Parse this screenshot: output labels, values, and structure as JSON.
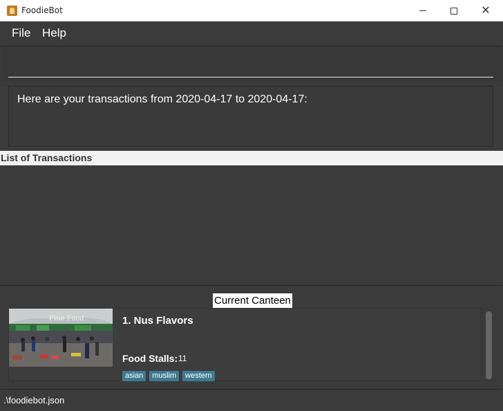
{
  "window": {
    "title": "FoodieBot",
    "minimize_icon": "minimize-icon",
    "maximize_icon": "maximize-icon",
    "close_label": "✕"
  },
  "menu": {
    "items": [
      {
        "label": "File"
      },
      {
        "label": "Help"
      }
    ]
  },
  "command": {
    "value": "",
    "placeholder": ""
  },
  "result": {
    "text": "Here are your transactions from 2020-04-17 to 2020-04-17:"
  },
  "transactions": {
    "header": "List of Transactions",
    "items": []
  },
  "canteen": {
    "label": "Current Canteen",
    "card": {
      "title": "1.  Nus Flavors",
      "stalls_label": "Food Stalls:",
      "stalls_count": "11",
      "tags": [
        "asian",
        "muslim",
        "western"
      ],
      "image_icon": "canteen-photo"
    }
  },
  "status": {
    "path": ".\\foodiebot.json"
  },
  "colors": {
    "background": "#3b3b3b",
    "tag": "#3e7b91",
    "header": "#f2f2f2"
  }
}
